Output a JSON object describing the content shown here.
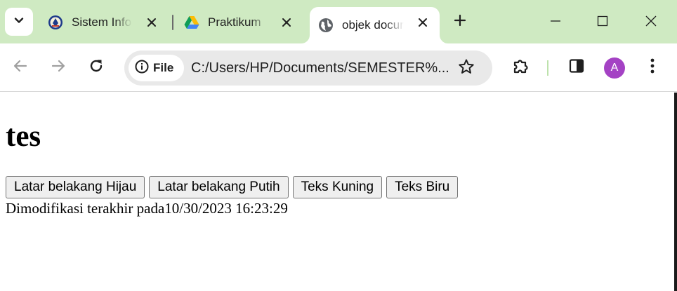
{
  "browser": {
    "tabs": [
      {
        "title": "Sistem Informasi",
        "favicon": "university-seal-icon"
      },
      {
        "title": "Praktikum",
        "favicon": "google-drive-icon"
      },
      {
        "title": "objek document",
        "favicon": "globe-icon",
        "active": true
      }
    ],
    "address": {
      "chip_label": "File",
      "url": "C:/Users/HP/Documents/SEMESTER%..."
    },
    "profile_initial": "A",
    "colors": {
      "frame": "#cfeac2",
      "avatar": "#a442c4",
      "omnibox": "#e9e9e9"
    }
  },
  "page": {
    "heading": "tes",
    "buttons": [
      "Latar belakang Hijau",
      "Latar belakang Putih",
      "Teks Kuning",
      "Teks Biru"
    ],
    "modified_label": "Dimodifikasi terakhir pada",
    "modified_value": "10/30/2023 16:23:29"
  }
}
